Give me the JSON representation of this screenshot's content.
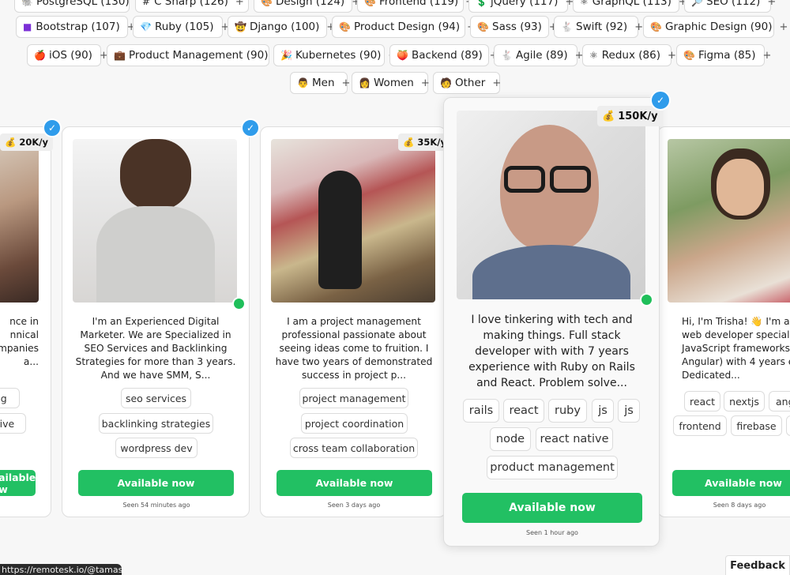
{
  "filters": {
    "row0": [
      {
        "icon": "🐘",
        "label": "PostgreSQL (130)"
      },
      {
        "icon": "#",
        "label": "C Sharp (126)"
      },
      {
        "icon": "🎨",
        "label": "Design (124)"
      },
      {
        "icon": "🎨",
        "label": "Frontend (119)"
      },
      {
        "icon": "💲",
        "label": "jQuery (117)"
      },
      {
        "icon": "⚛",
        "label": "GraphQL (113)"
      },
      {
        "icon": "🔎",
        "label": "SEO (112)"
      }
    ],
    "row1": [
      {
        "icon": "■",
        "label": "Bootstrap (107)"
      },
      {
        "icon": "💎",
        "label": "Ruby (105)"
      },
      {
        "icon": "🤠",
        "label": "Django (100)"
      },
      {
        "icon": "🎨",
        "label": "Product Design (94)"
      },
      {
        "icon": "🎨",
        "label": "Sass (93)"
      },
      {
        "icon": "🐇",
        "label": "Swift (92)"
      },
      {
        "icon": "🎨",
        "label": "Graphic Design (90)"
      }
    ],
    "row2": [
      {
        "icon": "🍎",
        "label": "iOS (90)"
      },
      {
        "icon": "💼",
        "label": "Product Management (90)"
      },
      {
        "icon": "🎉",
        "label": "Kubernetes (90)"
      },
      {
        "icon": "🍑",
        "label": "Backend (89)"
      },
      {
        "icon": "🐇",
        "label": "Agile (89)"
      },
      {
        "icon": "⚛",
        "label": "Redux (86)"
      },
      {
        "icon": "🎨",
        "label": "Figma (85)"
      }
    ],
    "row3": [
      {
        "icon": "👨",
        "label": "Men"
      },
      {
        "icon": "👩",
        "label": "Women"
      },
      {
        "icon": "🧑",
        "label": "Other"
      }
    ],
    "plus": "+"
  },
  "cards": [
    {
      "salary": "20K/y",
      "bio": "nce in\nnnical\nmpanies\na...",
      "tags": [
        "ing",
        "ctive"
      ],
      "available": "Available now",
      "seen": ""
    },
    {
      "salary": "",
      "bio": "I'm an Experienced Digital Marketer. We are Specialized in SEO Services and Backlinking Strategies for more than 3 years. And we have SMM, S...",
      "tags": [
        "seo services",
        "backlinking strategies",
        "wordpress dev"
      ],
      "available": "Available now",
      "seen": "Seen 54 minutes ago"
    },
    {
      "salary": "35K/y",
      "bio": "I am a project management professional passionate about seeing ideas come to fruition. I have two years of demonstrated success in project p...",
      "tags": [
        "project management",
        "project coordination",
        "cross team collaboration"
      ],
      "available": "Available now",
      "seen": "Seen 3 days ago"
    },
    {
      "salary": "150K/y",
      "bio": "I love tinkering with tech and making things. Full stack developer with with 7 years experience with Ruby on Rails and React. Problem solve...",
      "tags": [
        "rails",
        "react",
        "ruby",
        "js",
        "js",
        "node",
        "react native",
        "product management"
      ],
      "available": "Available now",
      "seen": "Seen 1 hour ago"
    },
    {
      "salary": "",
      "bio": "Hi, I'm Trisha! 👋 I'm a fro\nweb developer specializ\nJavaScript frameworks (R\nAngular) with 4 years expe\nDedicated...",
      "tags": [
        "react",
        "nextjs",
        "ang",
        "frontend",
        "firebase",
        ""
      ],
      "available": "Available now",
      "seen": "Seen 8 days ago"
    }
  ],
  "salary_icon": "💰",
  "verified_mark": "✓",
  "statusbar": "https://remotesk.io/@tamas",
  "feedback": "Feedback",
  "colors": {
    "green": "#22c063",
    "blue": "#2f9ceb"
  }
}
